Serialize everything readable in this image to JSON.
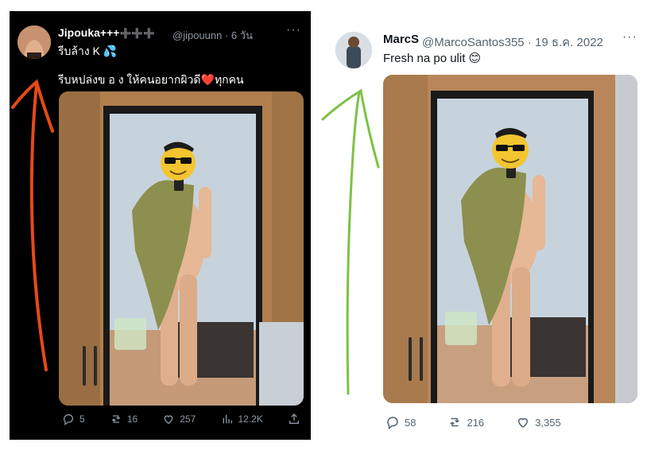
{
  "left_tweet": {
    "display_name": "Jipouka+++",
    "name_suffix": "➕➕➕",
    "handle": "@jipouunn",
    "time": "· 6 วัน",
    "text_line1": "รีบล้าง K 💦",
    "text_line2": "รีบหปล่งข อ ง ให้คนอยากผิวดี❤️ทุกคน",
    "more": "···",
    "stats": {
      "replies": "5",
      "retweets": "16",
      "likes": "257",
      "views": "12.2K"
    }
  },
  "right_tweet": {
    "display_name": "MarcS",
    "handle": "@MarcoSantos355",
    "time": "· 19 ธ.ค. 2022",
    "text": "Fresh na po ulit 😊",
    "more": "···",
    "stats": {
      "replies": "58",
      "retweets": "216",
      "likes": "3,355"
    }
  },
  "colors": {
    "left_arrow": "#e64a19",
    "right_arrow": "#7cc242",
    "dark_bg": "#000000",
    "icon_gray": "#536471"
  },
  "icons": [
    "reply-icon",
    "retweet-icon",
    "like-icon",
    "views-icon",
    "share-icon",
    "more-icon",
    "sunglasses-emoji"
  ]
}
